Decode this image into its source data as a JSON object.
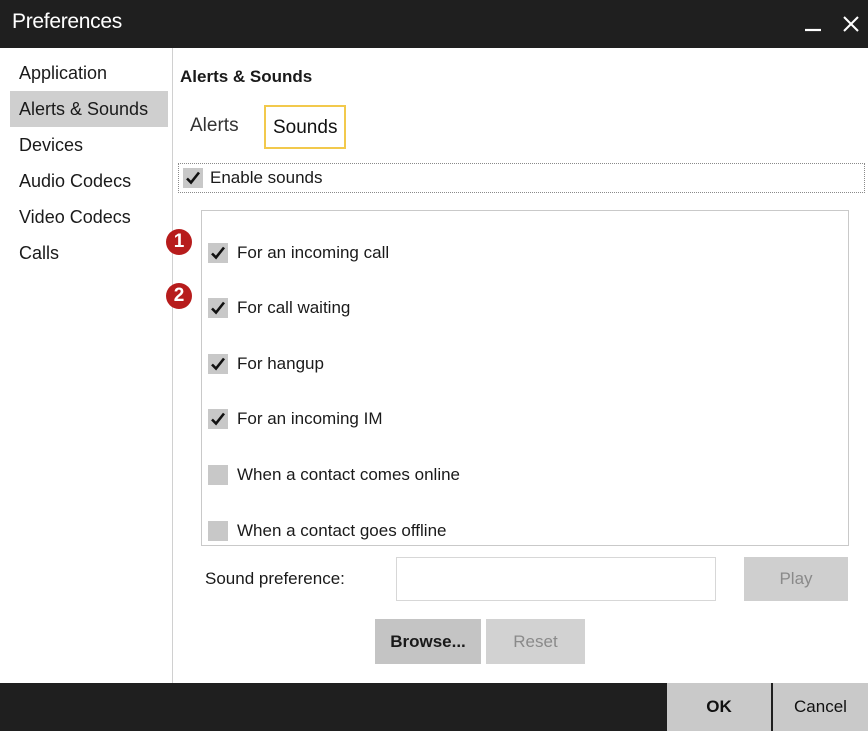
{
  "window": {
    "title": "Preferences",
    "minimize_icon": "minimize-icon",
    "close_icon": "close-icon"
  },
  "sidebar": {
    "items": [
      {
        "label": "Application",
        "active": false
      },
      {
        "label": "Alerts & Sounds",
        "active": true
      },
      {
        "label": "Devices",
        "active": false
      },
      {
        "label": "Audio Codecs",
        "active": false
      },
      {
        "label": "Video Codecs",
        "active": false
      },
      {
        "label": "Calls",
        "active": false
      }
    ]
  },
  "main": {
    "section_title": "Alerts & Sounds",
    "tabs": [
      {
        "label": "Alerts",
        "selected": false
      },
      {
        "label": "Sounds",
        "selected": true
      }
    ],
    "enable_sounds": {
      "label": "Enable sounds",
      "checked": true
    },
    "options": [
      {
        "label": "For an incoming call",
        "checked": true,
        "badge": "1"
      },
      {
        "label": "For call waiting",
        "checked": true,
        "badge": "2"
      },
      {
        "label": "For hangup",
        "checked": true
      },
      {
        "label": "For an incoming IM",
        "checked": true
      },
      {
        "label": "When a contact comes online",
        "checked": false
      },
      {
        "label": "When a contact goes offline",
        "checked": false
      }
    ],
    "sound_preference": {
      "label": "Sound preference:",
      "value": ""
    },
    "buttons": {
      "play": "Play",
      "browse": "Browse...",
      "reset": "Reset"
    }
  },
  "footer": {
    "ok": "OK",
    "cancel": "Cancel"
  },
  "colors": {
    "titlebar_bg": "#1f1f1f",
    "active_item_bg": "#cfcfcf",
    "tab_focus_border": "#f2c94c",
    "badge_bg": "#b71c1c"
  }
}
